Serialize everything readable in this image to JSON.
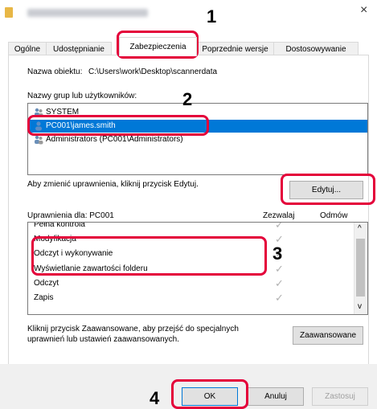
{
  "window": {
    "title_blurred": "",
    "close_glyph": "×"
  },
  "tabs": [
    {
      "label": "Ogólne"
    },
    {
      "label": "Udostępnianie"
    },
    {
      "label": "Zabezpieczenia"
    },
    {
      "label": "Poprzednie wersje"
    },
    {
      "label": "Dostosowywanie"
    }
  ],
  "object": {
    "label": "Nazwa obiektu:",
    "path": "C:\\Users\\work\\Desktop\\scannerdata"
  },
  "groups": {
    "heading": "Nazwy grup lub użytkowników:",
    "items": [
      {
        "name": "SYSTEM",
        "icon": "users-icon"
      },
      {
        "name": "PC001\\james.smith",
        "icon": "user-icon",
        "selected": true
      },
      {
        "name": "Administrators (PC001\\Administrators)",
        "icon": "users-icon"
      }
    ]
  },
  "edit_hint": "Aby zmienić uprawnienia, kliknij przycisk Edytuj.",
  "edit_button": "Edytuj...",
  "permissions": {
    "heading": "Uprawnienia dla: PC001",
    "col_allow": "Zezwalaj",
    "col_deny": "Odmów",
    "rows": [
      {
        "name": "Pełna kontrola",
        "allow": true
      },
      {
        "name": "Modyfikacja",
        "allow": true
      },
      {
        "name": "Odczyt i wykonywanie",
        "allow": true
      },
      {
        "name": "Wyświetlanie zawartości folderu",
        "allow": true
      },
      {
        "name": "Odczyt",
        "allow": true
      },
      {
        "name": "Zapis",
        "allow": true
      }
    ],
    "check_glyph": "✓"
  },
  "advanced_hint_line1": "Kliknij przycisk Zaawansowane, aby przejść do specjalnych",
  "advanced_hint_line2": "uprawnień lub ustawień zaawansowanych.",
  "advanced_button": "Zaawansowane",
  "footer": {
    "ok": "OK",
    "cancel": "Anuluj",
    "apply": "Zastosuj"
  },
  "callouts": [
    "1",
    "2",
    "3",
    "4"
  ],
  "scroll": {
    "up": "^",
    "down": "v"
  },
  "colors": {
    "highlight": "#e4003a",
    "selection": "#0078d7"
  }
}
